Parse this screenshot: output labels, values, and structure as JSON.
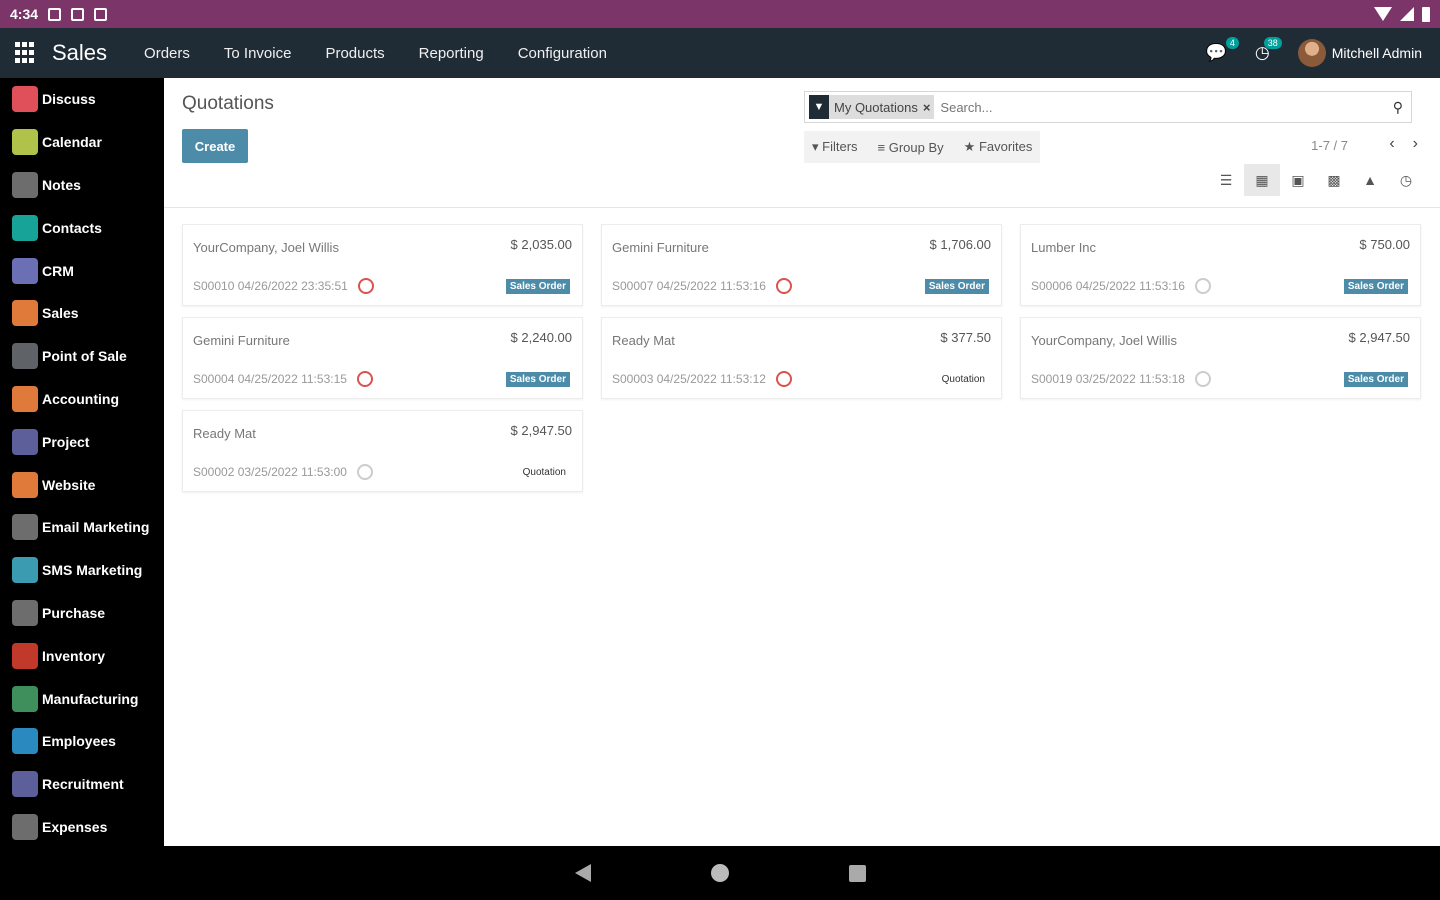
{
  "statusbar": {
    "time": "4:34"
  },
  "nav": {
    "brand": "Sales",
    "menus": [
      "Orders",
      "To Invoice",
      "Products",
      "Reporting",
      "Configuration"
    ],
    "messages_count": "4",
    "activities_count": "38",
    "user_name": "Mitchell Admin"
  },
  "sidebar": {
    "items": [
      {
        "label": "Discuss",
        "color": "#e0505a"
      },
      {
        "label": "Calendar",
        "color": "#b0c24a"
      },
      {
        "label": "Notes",
        "color": "#6d6d6d"
      },
      {
        "label": "Contacts",
        "color": "#17a398"
      },
      {
        "label": "CRM",
        "color": "#6b6fb4"
      },
      {
        "label": "Sales",
        "color": "#e07a3a"
      },
      {
        "label": "Point of Sale",
        "color": "#5f6368"
      },
      {
        "label": "Accounting",
        "color": "#e07a3a"
      },
      {
        "label": "Project",
        "color": "#5c5f9a"
      },
      {
        "label": "Website",
        "color": "#e07a3a"
      },
      {
        "label": "Email Marketing",
        "color": "#6d6d6d"
      },
      {
        "label": "SMS Marketing",
        "color": "#3b9bb0"
      },
      {
        "label": "Purchase",
        "color": "#6d6d6d"
      },
      {
        "label": "Inventory",
        "color": "#c0392b"
      },
      {
        "label": "Manufacturing",
        "color": "#3f8f5c"
      },
      {
        "label": "Employees",
        "color": "#2a8ac0"
      },
      {
        "label": "Recruitment",
        "color": "#5c5f9a"
      },
      {
        "label": "Expenses",
        "color": "#6d6d6d"
      }
    ]
  },
  "main": {
    "title": "Quotations",
    "create_label": "Create",
    "search_facet": "My Quotations",
    "search_placeholder": "Search...",
    "filters_label": "Filters",
    "groupby_label": "Group By",
    "favorites_label": "Favorites",
    "pager": "1-7 / 7"
  },
  "cards": [
    {
      "customer": "YourCompany, Joel Willis",
      "amount": "$ 2,035.00",
      "ref": "S00010 04/26/2022 23:35:51",
      "overdue": true,
      "state": "Sales Order"
    },
    {
      "customer": "Gemini Furniture",
      "amount": "$ 1,706.00",
      "ref": "S00007 04/25/2022 11:53:16",
      "overdue": true,
      "state": "Sales Order"
    },
    {
      "customer": "Lumber Inc",
      "amount": "$ 750.00",
      "ref": "S00006 04/25/2022 11:53:16",
      "overdue": false,
      "state": "Sales Order"
    },
    {
      "customer": "Gemini Furniture",
      "amount": "$ 2,240.00",
      "ref": "S00004 04/25/2022 11:53:15",
      "overdue": true,
      "state": "Sales Order"
    },
    {
      "customer": "Ready Mat",
      "amount": "$ 377.50",
      "ref": "S00003 04/25/2022 11:53:12",
      "overdue": true,
      "state": "Quotation"
    },
    {
      "customer": "YourCompany, Joel Willis",
      "amount": "$ 2,947.50",
      "ref": "S00019 03/25/2022 11:53:18",
      "overdue": false,
      "state": "Sales Order"
    },
    {
      "customer": "Ready Mat",
      "amount": "$ 2,947.50",
      "ref": "S00002 03/25/2022 11:53:00",
      "overdue": false,
      "state": "Quotation"
    }
  ]
}
